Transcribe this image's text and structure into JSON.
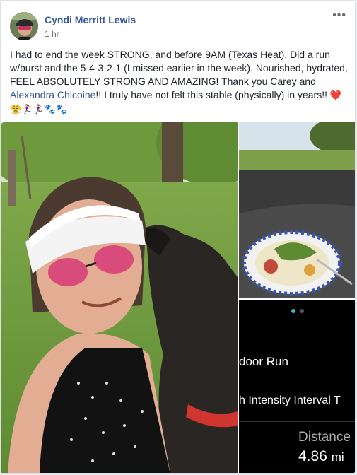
{
  "post": {
    "author": "Cyndi Merritt Lewis",
    "time": "1 hr",
    "menu_glyph": "•••",
    "text_part1": "I had to end the week STRONG, and before 9AM (Texas Heat). Did a run w/burst and the 5-4-3-2-1 (I missed earlier in the week). Nourished, hydrated, FEEL ABSOLUTELY STRONG AND AMAZING! Thank you Carey and ",
    "mention": "Alexandra Chicoine",
    "text_part2": "!! I truly have not felt this stable (physically) in years!! ",
    "emojis": "❤️😤🏃‍♀️🏃‍♀️🐾🐾"
  },
  "workout": {
    "line1": "door Run",
    "line2": "h Intensity Interval T",
    "distance_label": "Distance",
    "distance_value": "4.86",
    "distance_unit": "mi"
  },
  "carousel": {
    "active": 0,
    "count": 2
  }
}
